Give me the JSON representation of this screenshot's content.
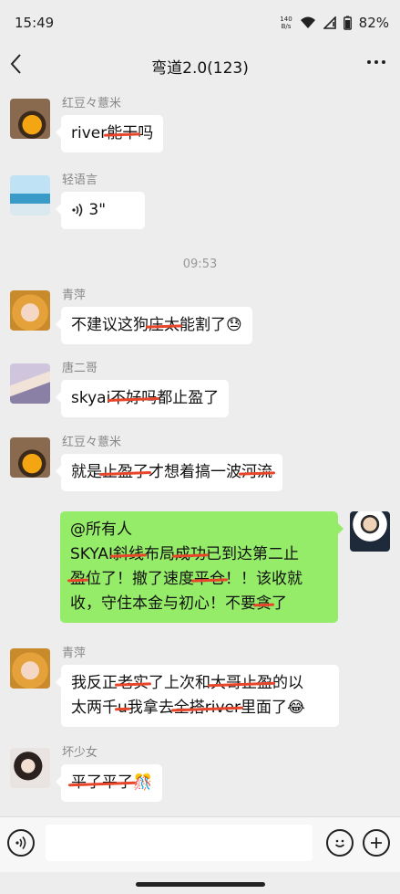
{
  "status": {
    "time": "15:49",
    "net_speed_value": "140",
    "net_speed_unit": "B/s",
    "battery": "82%",
    "icons": [
      "wifi-icon",
      "signal-icon",
      "battery-icon"
    ]
  },
  "nav": {
    "title": "弯道2.0(123)",
    "back_icon": "chevron-left-icon",
    "more_icon": "more-icon"
  },
  "messages": [
    {
      "sender": "红豆々薏米",
      "parts": [
        "river",
        "能干",
        "吗"
      ]
    },
    {
      "sender": "轻语言",
      "voice_duration": "3\""
    },
    {
      "timestamp": "09:53"
    },
    {
      "sender": "青萍",
      "parts": [
        "不建议这狗",
        "庄太",
        "能割了",
        "😓"
      ]
    },
    {
      "sender": "唐二哥",
      "parts": [
        "skyai",
        "不好吗",
        "都止盈了"
      ]
    },
    {
      "sender": "红豆々薏米",
      "parts": [
        "就是",
        "止盈了",
        "才想着搞一波",
        "河流"
      ]
    },
    {
      "sender": "me",
      "lines": [
        [
          "@所有人"
        ],
        [
          "SKYAI",
          "斜线",
          "布局",
          "成功",
          "已到达第二止"
        ],
        [
          "盈",
          "位了！撤了速度",
          "平仓",
          "！！该收就"
        ],
        [
          "收，守住本金与初心！不要",
          "贪",
          "了"
        ]
      ]
    },
    {
      "sender": "青萍",
      "lines": [
        [
          "我反正",
          "老实",
          "了上次和",
          "大哥止盈",
          "的以"
        ],
        [
          "太两千",
          "u",
          "我拿去",
          "全搭river",
          "里面了",
          "😂"
        ]
      ]
    },
    {
      "sender": "坏少女",
      "parts": [
        "平了平了",
        "🎊"
      ]
    }
  ],
  "input": {
    "voice_icon": "voice-icon",
    "emoji_icon": "emoji-icon",
    "plus_icon": "plus-icon"
  },
  "colors": {
    "background": "#ededed",
    "my_bubble": "#95ec69",
    "strike": "#e8462b"
  }
}
